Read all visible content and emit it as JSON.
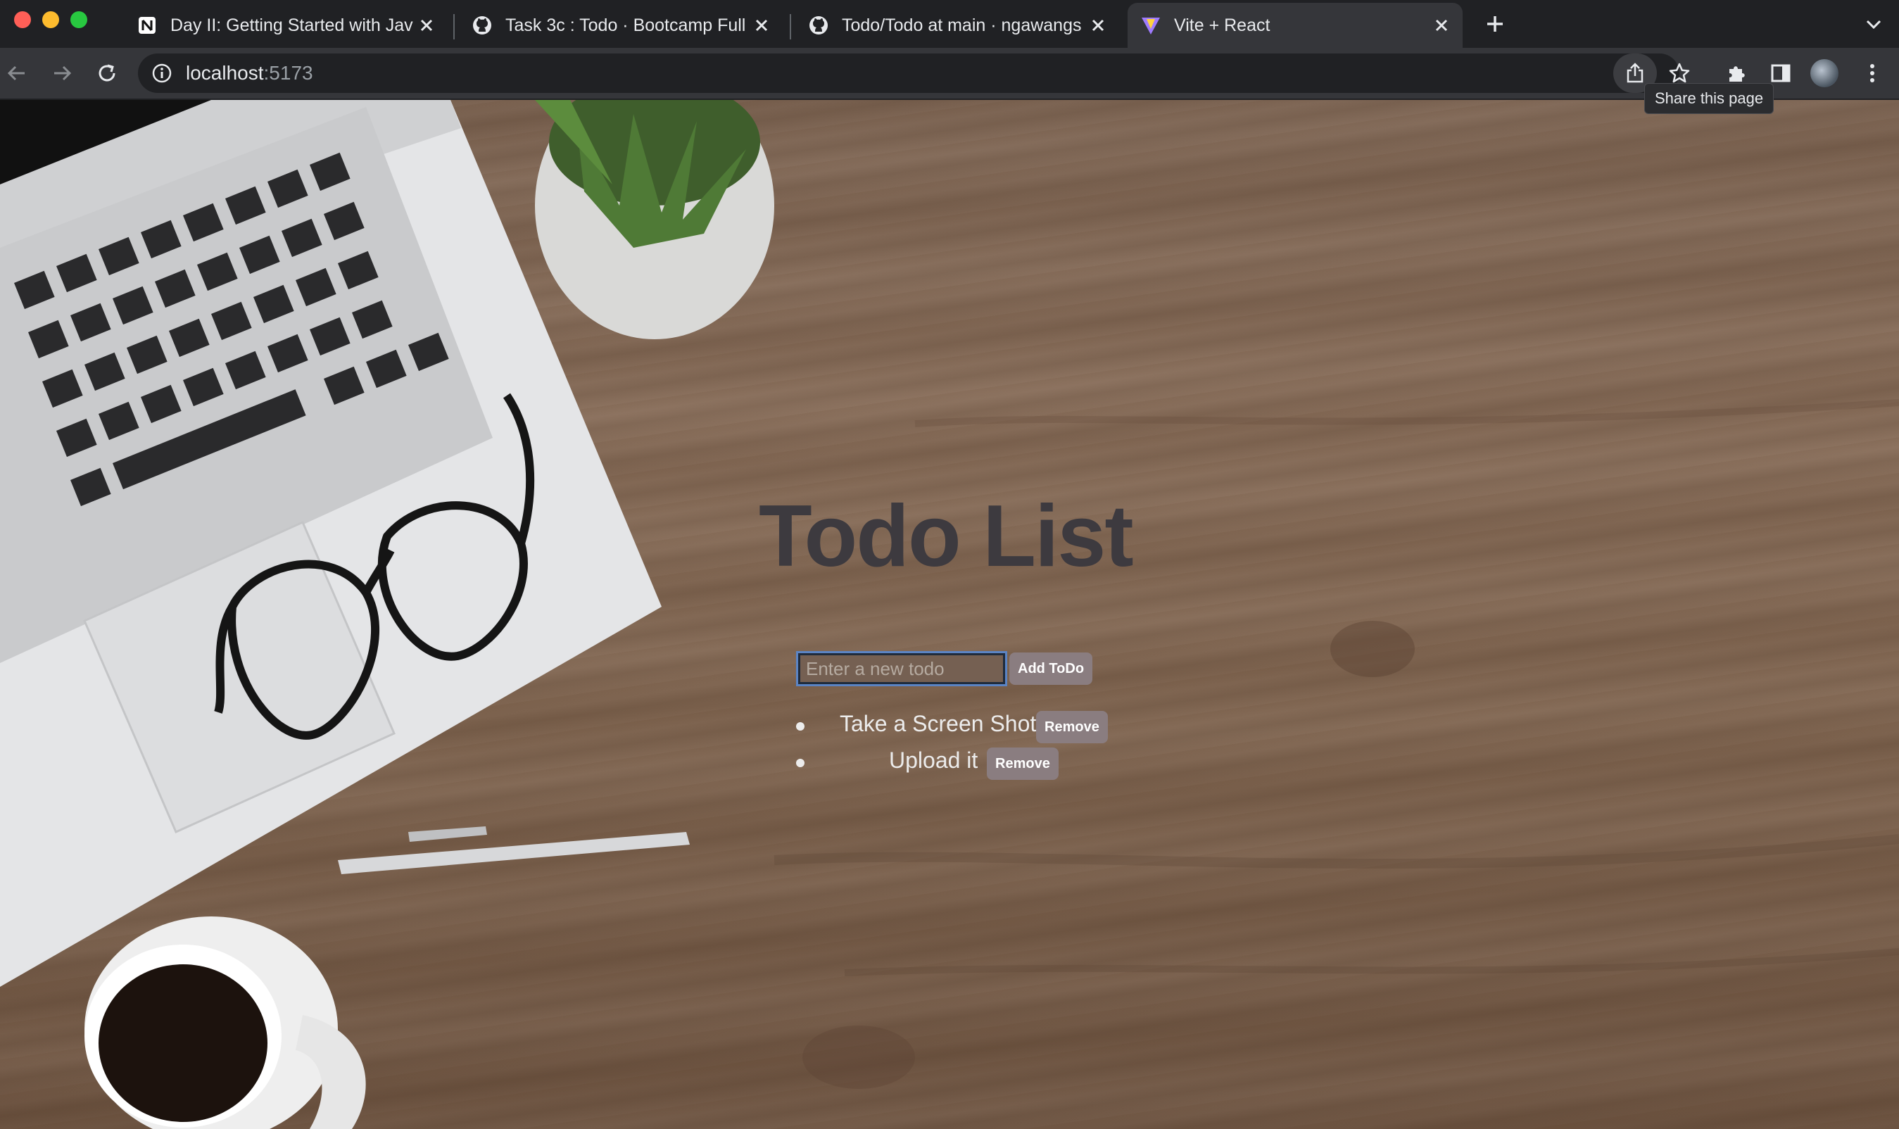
{
  "browser": {
    "tabs": [
      {
        "title": "Day II: Getting Started with Jav",
        "icon": "notion-icon"
      },
      {
        "title": "Task 3c : Todo · Bootcamp Full",
        "icon": "github-icon"
      },
      {
        "title": "Todo/Todo at main · ngawangs",
        "icon": "github-icon"
      },
      {
        "title": "Vite + React",
        "icon": "vite-icon",
        "active": true
      }
    ],
    "url_host": "localhost",
    "url_port": ":5173",
    "tooltip": "Share this page"
  },
  "app": {
    "title": "Todo List",
    "input_placeholder": "Enter a new todo",
    "input_value": "",
    "add_label": "Add ToDo",
    "todos": [
      {
        "text": "Take a Screen Shot",
        "remove_label": "Remove"
      },
      {
        "text": "Upload it",
        "remove_label": "Remove"
      }
    ]
  },
  "colors": {
    "title": "#3d3a3f",
    "button_bg": "#8a7d80",
    "input_focus": "#5b84c4",
    "tab_active": "#35363a",
    "tabstrip": "#202124"
  }
}
